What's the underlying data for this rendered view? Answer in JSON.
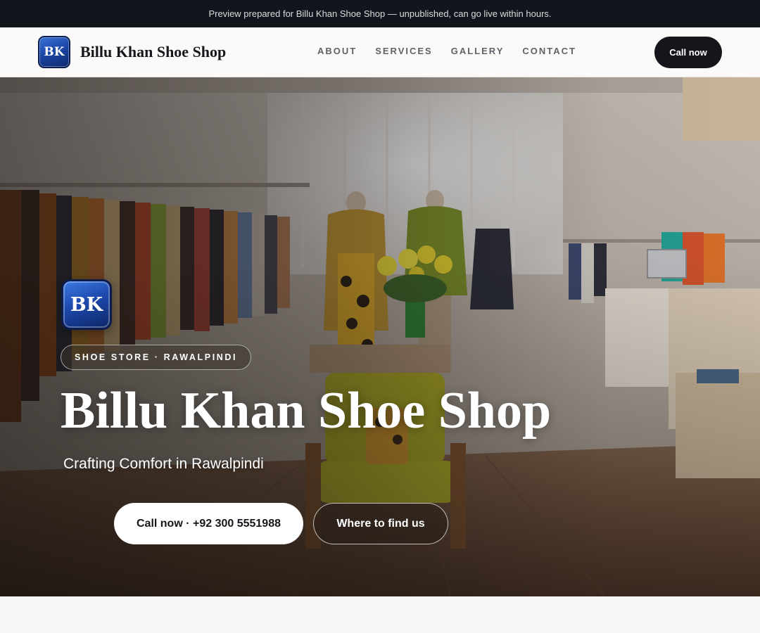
{
  "preview_banner": "Preview prepared for Billu Khan Shoe Shop — unpublished, can go live within hours.",
  "header": {
    "logo_initials": "BK",
    "brand_name": "Billu Khan Shoe Shop",
    "nav": [
      {
        "label": "ABOUT"
      },
      {
        "label": "SERVICES"
      },
      {
        "label": "GALLERY"
      },
      {
        "label": "CONTACT"
      }
    ],
    "cta_label": "Call now"
  },
  "hero": {
    "logo_initials": "BK",
    "tag": "SHOE STORE · RAWALPINDI",
    "title": "Billu Khan Shoe Shop",
    "subtitle": "Crafting Comfort in Rawalpindi",
    "primary_button": "Call now · +92 300 5551988",
    "secondary_button": "Where to find us"
  },
  "colors": {
    "banner_bg": "#12151b",
    "header_bg": "#fbfaf8",
    "cta_bg": "#14161b",
    "logo_blue": "#1d49ad",
    "page_bg": "#f9f8f6"
  }
}
